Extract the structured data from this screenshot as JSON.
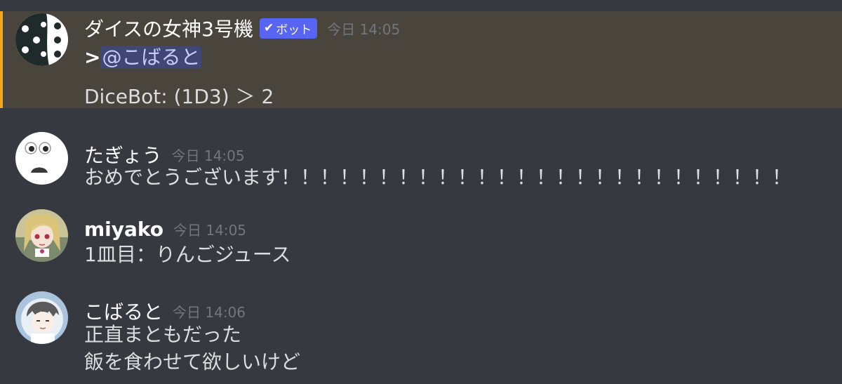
{
  "messages": [
    {
      "author": "ダイスの女神3号機",
      "bot_tag": "ボット",
      "timestamp": "今日 14:05",
      "prefix": ">",
      "mention": "@こばると",
      "line2": "DiceBot: (1D3) ＞ 2",
      "highlight_color": "#faa61a"
    },
    {
      "author": "たぎょう",
      "timestamp": "今日 14:05",
      "line1": "おめでとうございます！！！！！！！！！！！！！！！！！！！！！！！！！！"
    },
    {
      "author": "miyako",
      "timestamp": "今日 14:05",
      "line1": "1皿目：りんごジュース"
    },
    {
      "author": "こばると",
      "timestamp": "今日 14:06",
      "line1": "正直まともだった",
      "line2": "飯を食わせて欲しいけど"
    }
  ],
  "colors": {
    "background": "#36393f",
    "highlight_bg": "#49443c",
    "mention_bg": "#414675",
    "bot_tag": "#5865f2"
  },
  "icons": [
    "dice-avatar-icon",
    "face-avatar-icon",
    "anime-girl-avatar-icon",
    "anime-boy-avatar-icon",
    "check-icon"
  ]
}
